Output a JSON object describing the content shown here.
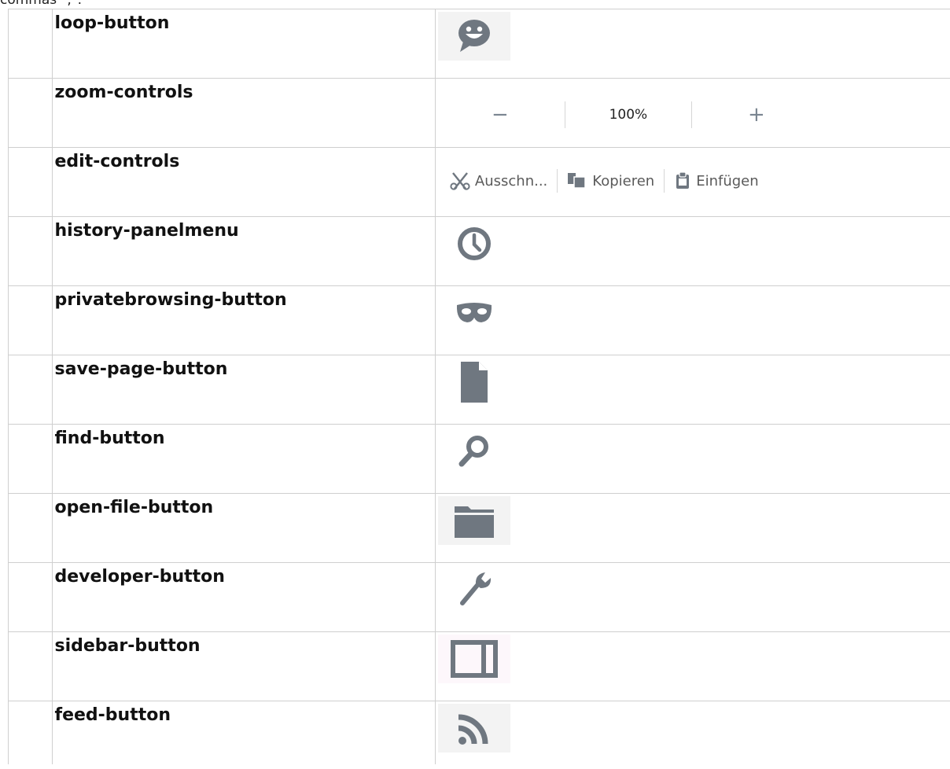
{
  "intro_text": "commas \",\".",
  "rows": [
    {
      "name": "loop-button",
      "icon": "smiley-speech-icon"
    },
    {
      "name": "zoom-controls",
      "zoom": {
        "minus": "−",
        "value": "100%",
        "plus": "+"
      }
    },
    {
      "name": "edit-controls",
      "edit": {
        "cut": "Ausschn...",
        "copy": "Kopieren",
        "paste": "Einfügen"
      }
    },
    {
      "name": "history-panelmenu",
      "icon": "clock-icon"
    },
    {
      "name": "privatebrowsing-button",
      "icon": "mask-icon"
    },
    {
      "name": "save-page-button",
      "icon": "page-icon"
    },
    {
      "name": "find-button",
      "icon": "magnifier-icon"
    },
    {
      "name": "open-file-button",
      "icon": "folder-icon"
    },
    {
      "name": "developer-button",
      "icon": "wrench-icon"
    },
    {
      "name": "sidebar-button",
      "icon": "sidebar-icon"
    },
    {
      "name": "feed-button",
      "icon": "rss-icon"
    }
  ],
  "colors": {
    "icon": "#6f7780",
    "border": "#cfcfcf"
  }
}
